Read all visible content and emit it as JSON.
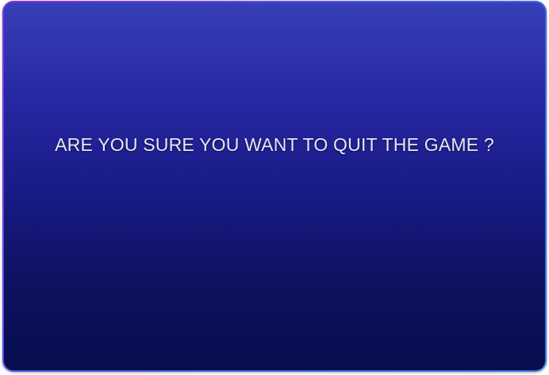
{
  "dialog": {
    "message": "ARE YOU SURE YOU WANT TO QUIT THE GAME ?"
  },
  "colors": {
    "background_top": "#3740b8",
    "background_bottom": "#070d4c",
    "border_left": "#8a2fd6",
    "border_right": "#2f7fe6",
    "text": "#e6e8f4"
  }
}
